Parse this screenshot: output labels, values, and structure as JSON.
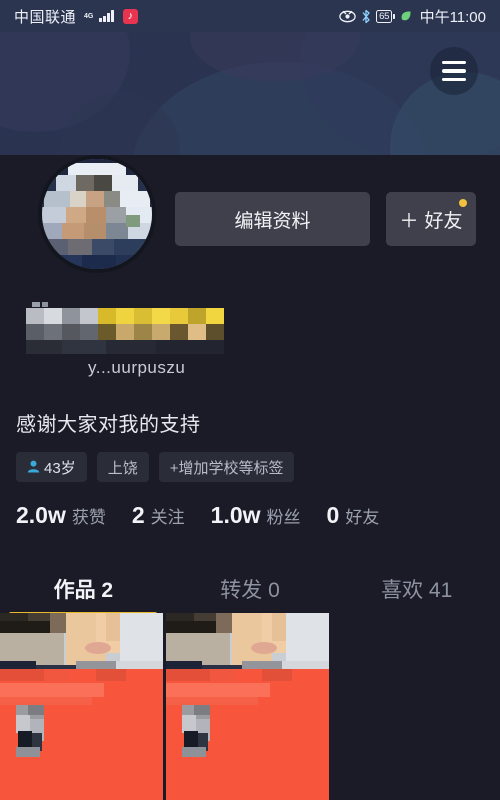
{
  "status_bar": {
    "carrier": "中国联通",
    "network": "4G",
    "app_icon": "douyin-icon",
    "eye_comfort_icon": "eye-icon",
    "bluetooth_icon": "bluetooth-icon",
    "battery_level": "65",
    "eco_icon": "leaf-icon",
    "time": "中午11:00"
  },
  "header": {
    "menu_icon": "hamburger-menu-icon",
    "banner_color": "#2a3450"
  },
  "profile": {
    "avatar": "user-avatar",
    "display_name_censored": true,
    "handle": "y...uurpuszu",
    "bio": "感谢大家对我的支持",
    "tags": [
      {
        "icon": "person-icon",
        "label": "43岁"
      },
      {
        "icon": "",
        "label": "上饶"
      },
      {
        "icon": "plus",
        "label": "+增加学校等标签"
      }
    ],
    "stats": [
      {
        "value": "2.0w",
        "label": "获赞"
      },
      {
        "value": "2",
        "label": "关注"
      },
      {
        "value": "1.0w",
        "label": "粉丝"
      },
      {
        "value": "0",
        "label": "好友"
      }
    ]
  },
  "actions": {
    "edit_profile_label": "编辑资料",
    "add_friend_plus": "＋",
    "add_friend_label": "好友",
    "badge_color": "#f2c03c"
  },
  "tabs": [
    {
      "label": "作品 2",
      "active": true
    },
    {
      "label": "转发 0",
      "active": false
    },
    {
      "label": "喜欢 41",
      "active": false
    }
  ],
  "tabs_accent": "#e8b92c",
  "grid": {
    "items": [
      {
        "name": "video-thumbnail-1"
      },
      {
        "name": "video-thumbnail-2"
      }
    ]
  }
}
